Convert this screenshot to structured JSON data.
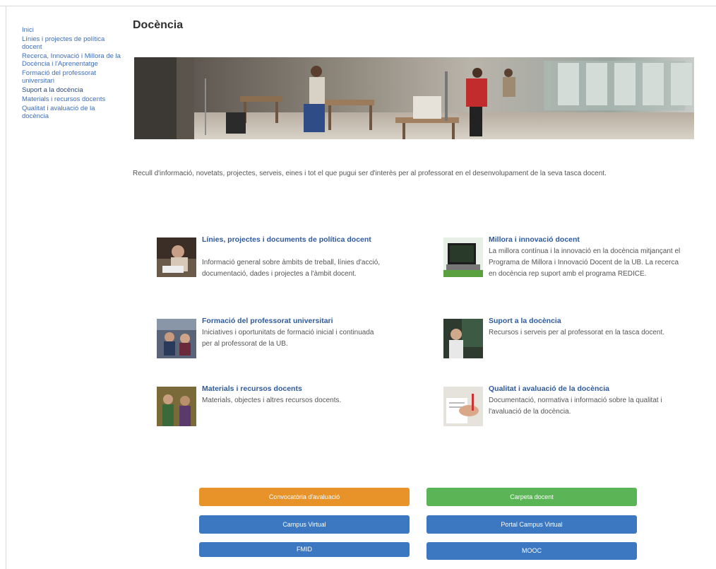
{
  "colors": {
    "orange": "#e8922a",
    "green": "#5bb455",
    "blue": "#3b78c1",
    "link": "#3f6fb7",
    "title": "#2d5aa0"
  },
  "sidebar": {
    "items": [
      "Inici",
      "Línies i projectes de política docent",
      "Recerca, Innovació i Millora de la Docència i l'Aprenentatge",
      "Formació del professorat universitari",
      "Suport a la docència",
      "Materials i recursos docents",
      "Qualitat i avaluació de la docència"
    ]
  },
  "page": {
    "title": "Docència",
    "intro": "Recull d'informació, novetats, projectes, serveis, eines i tot el que pugui ser d'interès per al professorat en el desenvolupament de la seva tasca docent."
  },
  "cards": [
    {
      "icon": "teacher-writing-photo",
      "title": "Línies, projectes i documents de política docent",
      "desc": "Informació general sobre àmbits de treball, línies d'acció, documentació, dades i projectes a l'àmbit docent."
    },
    {
      "icon": "laptop-photo",
      "title": "Millora i innovació docent",
      "desc": "La millora contínua i la innovació en la docència mitjançant el Programa de Millora i Innovació Docent de la UB. La recerca en docència rep suport amb el programa REDICE."
    },
    {
      "icon": "classroom-photo",
      "title": "Formació del professorat universitari",
      "desc": "Iniciatives i oportunitats de formació inicial i continuada per al professorat de la UB."
    },
    {
      "icon": "lecturer-photo",
      "title": "Suport a la docència",
      "desc": "Recursos i serveis per al professorat en la tasca docent."
    },
    {
      "icon": "students-photo",
      "title": "Materials i recursos docents",
      "desc": "Materials, objectes i altres recursos docents."
    },
    {
      "icon": "hands-documents-photo",
      "title": "Qualitat i avaluació de la docència",
      "desc": "Documentació, normativa i informació sobre la qualitat i l'avaluació de la docència."
    }
  ],
  "buttons": {
    "convocatoria": "Convocatòria d'avaluació",
    "carpeta": "Carpeta docent",
    "campus": "Campus Virtual",
    "portal": "Portal Campus Virtual",
    "fmid": "FMID",
    "mooc": "MOOC"
  }
}
